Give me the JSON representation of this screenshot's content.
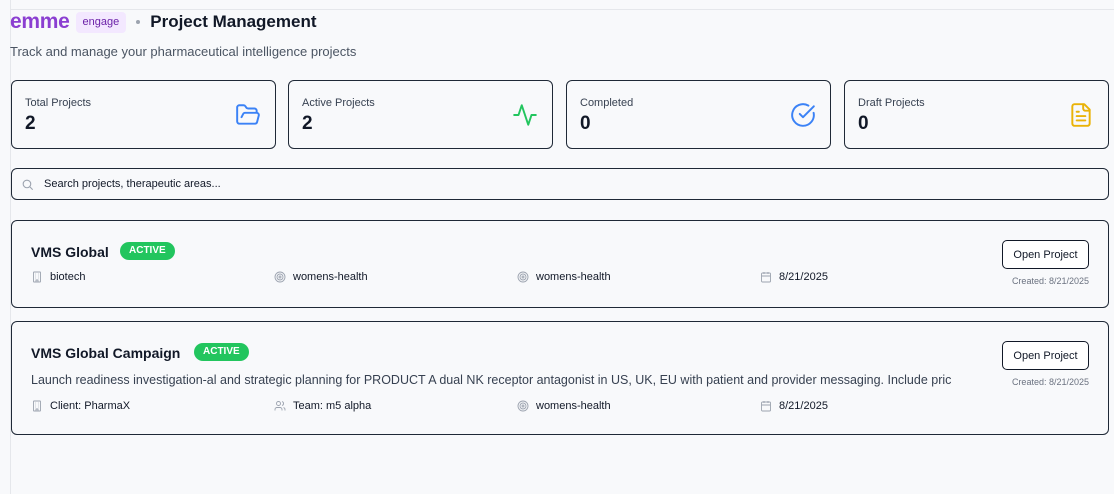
{
  "header": {
    "brand": "emme",
    "badge": "engage",
    "title": "Project Management",
    "subtitle": "Track and manage your pharmaceutical intelligence projects"
  },
  "stats": [
    {
      "label": "Total Projects",
      "value": "2",
      "icon": "folder-open-icon",
      "color": "#3b82f6"
    },
    {
      "label": "Active Projects",
      "value": "2",
      "icon": "activity-icon",
      "color": "#22c55e"
    },
    {
      "label": "Completed",
      "value": "0",
      "icon": "check-circle-icon",
      "color": "#3b82f6"
    },
    {
      "label": "Draft Projects",
      "value": "0",
      "icon": "file-text-icon",
      "color": "#eab308"
    }
  ],
  "search": {
    "placeholder": "Search projects, therapeutic areas...",
    "value": ""
  },
  "projects": [
    {
      "name": "VMS Global",
      "status": "ACTIVE",
      "description": "",
      "meta": [
        "biotech",
        "womens-health",
        "womens-health",
        "8/21/2025"
      ],
      "button": "Open Project",
      "created": "Created: 8/21/2025"
    },
    {
      "name": "VMS Global Campaign",
      "status": "ACTIVE",
      "description": "Launch readiness investigation-al and strategic planning for PRODUCT A dual NK receptor antagonist in US, UK, EU with patient and provider messaging. Include pric",
      "meta": [
        "Client: PharmaX",
        "Team: m5 alpha",
        "womens-health",
        "8/21/2025"
      ],
      "button": "Open Project",
      "created": "Created: 8/21/2025"
    }
  ],
  "colors": {
    "brand": "#8b3fd1",
    "active_badge": "#22c55e"
  }
}
